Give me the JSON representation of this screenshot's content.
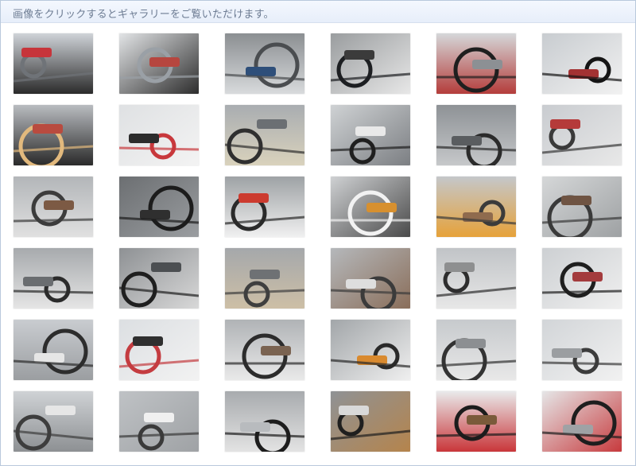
{
  "header": {
    "instruction": "画像をクリックするとギャラリーをご覧いただけます。"
  },
  "gallery": {
    "columns": 6,
    "thumbnails": [
      {
        "icon": "motorcycle-side-left-photo",
        "palette": [
          "#cfd3d8",
          "#6f7378",
          "#2b2b2b",
          "#c7353b"
        ]
      },
      {
        "icon": "motorcycle-side-right-photo",
        "palette": [
          "#e2e4e6",
          "#9aa0a6",
          "#2d2d2d",
          "#b6463f"
        ]
      },
      {
        "icon": "headlight-handlebar-photo",
        "palette": [
          "#8b8f92",
          "#4a4d50",
          "#d8dadc",
          "#2e4f7a"
        ]
      },
      {
        "icon": "speedometer-photo",
        "palette": [
          "#9a9d9f",
          "#1d1f22",
          "#e7e7e7",
          "#3b3b3b"
        ]
      },
      {
        "icon": "grip-handlebar-photo",
        "palette": [
          "#d5d7d9",
          "#1f1f1f",
          "#b43d3b",
          "#8c9094"
        ]
      },
      {
        "icon": "seat-rear-photo",
        "palette": [
          "#c8ccd0",
          "#151515",
          "#f1f1f1",
          "#a33233"
        ]
      },
      {
        "icon": "mirror-handlebar-photo",
        "palette": [
          "#b9bcc0",
          "#e2b97d",
          "#2a2a2a",
          "#b94b3f"
        ]
      },
      {
        "icon": "yamaha-fuel-tank-photo",
        "palette": [
          "#dfe1e3",
          "#c8383c",
          "#f3f3f3",
          "#2c2c2c"
        ]
      },
      {
        "icon": "ignition-key-photo",
        "palette": [
          "#a9adb1",
          "#2f2f2f",
          "#d9d2bc",
          "#6b6f73"
        ]
      },
      {
        "icon": "engine-block-photo",
        "palette": [
          "#cfd2d4",
          "#1f1f1f",
          "#7c7f83",
          "#e9e9e9"
        ]
      },
      {
        "icon": "engine-detail-photo",
        "palette": [
          "#8e9296",
          "#2b2b2b",
          "#c6c8ca",
          "#5a5d60"
        ]
      },
      {
        "icon": "footpeg-frame-photo",
        "palette": [
          "#c9ccd0",
          "#3a3a3a",
          "#e8e8e8",
          "#b53a3a"
        ]
      },
      {
        "icon": "rear-suspension-photo",
        "palette": [
          "#b3b6b9",
          "#3c3c3c",
          "#e0e0e0",
          "#7c5a44"
        ]
      },
      {
        "icon": "tire-tread-photo",
        "palette": [
          "#6c6f72",
          "#1c1c1c",
          "#9a9da0",
          "#2f2f2f"
        ]
      },
      {
        "icon": "tail-light-topdown-photo",
        "palette": [
          "#9ea2a5",
          "#2a2a2a",
          "#f0f0f0",
          "#cc3b2f"
        ]
      },
      {
        "icon": "rear-fender-exhaust-photo",
        "palette": [
          "#cfd1d3",
          "#f2f2f2",
          "#4a4a4a",
          "#d7902f"
        ]
      },
      {
        "icon": "turn-signal-shock-photo",
        "palette": [
          "#c4c7ca",
          "#3b3b3b",
          "#e6a23a",
          "#8f6b4e"
        ]
      },
      {
        "icon": "rear-wheel-hub-photo",
        "palette": [
          "#d5d7d8",
          "#3a3a3a",
          "#9ea1a3",
          "#6f5443"
        ]
      },
      {
        "icon": "shock-spring-closeup-photo",
        "palette": [
          "#a7aaad",
          "#2b2b2b",
          "#e5e5e5",
          "#6a6d70"
        ]
      },
      {
        "icon": "spring-tire-closeup-photo",
        "palette": [
          "#8e9194",
          "#1f1f1f",
          "#d8d8d8",
          "#4c4f52"
        ]
      },
      {
        "icon": "footpeg-ground-photo",
        "palette": [
          "#a5a8ab",
          "#3f3f3f",
          "#cdbfa6",
          "#6e7174"
        ]
      },
      {
        "icon": "kickstand-pedal-photo",
        "palette": [
          "#b5b8bb",
          "#3b3b3b",
          "#8a6e5a",
          "#dedede"
        ]
      },
      {
        "icon": "engine-side-photo",
        "palette": [
          "#c1c4c7",
          "#2e2e2e",
          "#e7e7e7",
          "#8e8f90"
        ]
      },
      {
        "icon": "side-panel-seat-photo",
        "palette": [
          "#cdd0d3",
          "#1f1f1f",
          "#efefef",
          "#a33b3d"
        ]
      },
      {
        "icon": "engine-lower-photo",
        "palette": [
          "#c9ccd0",
          "#2d2d2d",
          "#9b9ea1",
          "#e6e6e6"
        ]
      },
      {
        "icon": "yamaha-tank-side-photo",
        "palette": [
          "#dcdfe2",
          "#c43c40",
          "#f2f2f2",
          "#2f2f2f"
        ]
      },
      {
        "icon": "airbox-battery-photo",
        "palette": [
          "#b0b3b6",
          "#2c2c2c",
          "#e9e9e9",
          "#7a6351"
        ]
      },
      {
        "icon": "front-topdown-photo",
        "palette": [
          "#a2a6a9",
          "#2a2a2a",
          "#efefef",
          "#d98a2f"
        ]
      },
      {
        "icon": "fork-fender-photo",
        "palette": [
          "#c7cacd",
          "#333333",
          "#e8e8e8",
          "#8c8f92"
        ]
      },
      {
        "icon": "front-fork-photo",
        "palette": [
          "#d2d5d8",
          "#3c3c3c",
          "#f1f1f1",
          "#9b9ea1"
        ]
      },
      {
        "icon": "front-wheel-spokes-photo",
        "palette": [
          "#cfd2d5",
          "#3d3d3d",
          "#8d9093",
          "#e6e6e6"
        ]
      },
      {
        "icon": "rear-wheel-spokes-photo",
        "palette": [
          "#bfc2c5",
          "#3a3a3a",
          "#9fa2a5",
          "#f0f0f0"
        ]
      },
      {
        "icon": "seat-topdown-photo",
        "palette": [
          "#a8abae",
          "#1d1d1d",
          "#e3e3e3",
          "#b8bbbe"
        ]
      },
      {
        "icon": "wheel-tire-closeup-photo",
        "palette": [
          "#8f9295",
          "#1f1f1f",
          "#b5844c",
          "#d9d9d9"
        ]
      },
      {
        "icon": "fuel-cap-opening-photo",
        "palette": [
          "#e9eaeb",
          "#1c1c1c",
          "#c9363a",
          "#7a5a3a"
        ]
      },
      {
        "icon": "fuel-cap-removed-photo",
        "palette": [
          "#e5e6e7",
          "#1e1e1e",
          "#c73a3d",
          "#9fa2a5"
        ]
      }
    ]
  }
}
